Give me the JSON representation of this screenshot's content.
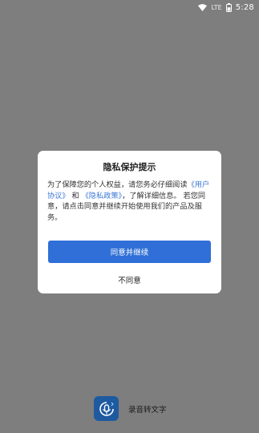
{
  "status_bar": {
    "signal_label": "LTE",
    "time": "5:28",
    "icons": [
      "wifi-icon",
      "battery-icon"
    ]
  },
  "privacy_dialog": {
    "title": "隐私保护提示",
    "body_before": "为了保障您的个人权益，请您务必仔细阅读",
    "user_agreement_link": "《用户协议》",
    "and_text": "和",
    "privacy_policy_link": "《隐私政策》",
    "body_after": "，了解详细信息。 若您同意，请点击同意并继续开始使用我们的产品及服务。",
    "agree_label": "同意并继续",
    "disagree_label": "不同意"
  },
  "app": {
    "name": "录音转文字",
    "logo_icon": "microphone-logo-icon"
  },
  "colors": {
    "overlay": "#7e7e7e",
    "accent": "#2f6fd7",
    "link": "#3a77d6",
    "logo_bg": "#1e5aa0"
  }
}
